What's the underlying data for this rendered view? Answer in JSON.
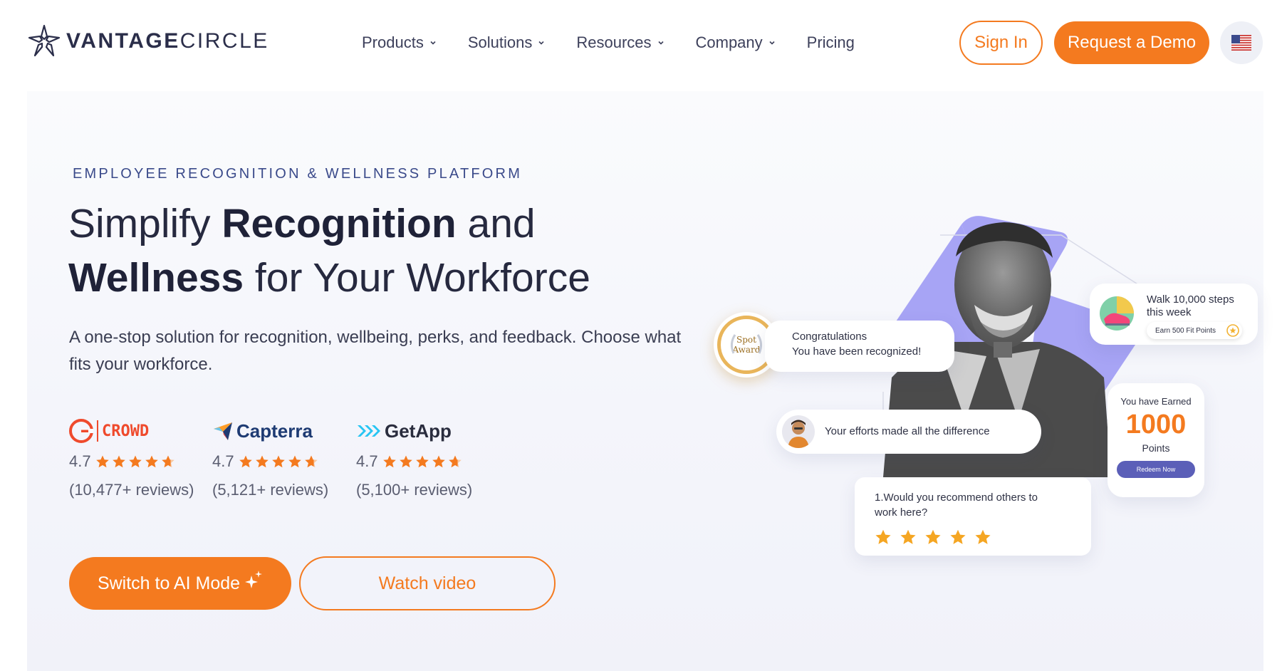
{
  "brand": {
    "name_bold": "VANTAGE",
    "name_light": "CIRCLE"
  },
  "nav": {
    "items": [
      {
        "label": "Products",
        "has_dropdown": true
      },
      {
        "label": "Solutions",
        "has_dropdown": true
      },
      {
        "label": "Resources",
        "has_dropdown": true
      },
      {
        "label": "Company",
        "has_dropdown": true
      },
      {
        "label": "Pricing",
        "has_dropdown": false
      }
    ],
    "signin_label": "Sign In",
    "demo_label": "Request a Demo",
    "locale_icon": "us-flag-icon"
  },
  "hero": {
    "eyebrow": "EMPLOYEE RECOGNITION & WELLNESS PLATFORM",
    "headline": {
      "line1_pre": "Simplify ",
      "line1_bold": "Recognition",
      "line1_post": " and",
      "line2_bold": "Wellness",
      "line2_post": " for Your Workforce"
    },
    "subtext": "A one-stop solution for recognition, wellbeing, perks, and feedback. Choose what fits your workforce.",
    "ratings": [
      {
        "brand": "CROWD",
        "score": "4.7",
        "stars": 4.7,
        "reviews": "(10,477+ reviews)"
      },
      {
        "brand": "Capterra",
        "score": "4.7",
        "stars": 4.7,
        "reviews": "(5,121+ reviews)"
      },
      {
        "brand": "GetApp",
        "score": "4.7",
        "stars": 4.7,
        "reviews": "(5,100+ reviews)"
      }
    ],
    "ai_button": "Switch to AI Mode",
    "watch_button": "Watch video"
  },
  "illustration": {
    "spot_award_line1": "Spot",
    "spot_award_line2": "Award",
    "congrats_line1": "Congratulations",
    "congrats_line2": "You have been recognized!",
    "walk_line1": "Walk 10,000 steps",
    "walk_line2": "this week",
    "walk_chip": "Earn 500 Fit Points",
    "efforts_text": "Your efforts made all the difference",
    "earned_label": "You have Earned",
    "earned_value": "1000",
    "earned_unit": "Points",
    "redeem_button": "Redeem Now",
    "survey_question_line1": "1.Would you recommend others to",
    "survey_question_line2": "work here?",
    "survey_stars": 5
  },
  "colors": {
    "accent": "#f47a1f",
    "navy": "#2b2e4a",
    "lavender": "#a7a4f5",
    "star": "#f47a1f"
  }
}
